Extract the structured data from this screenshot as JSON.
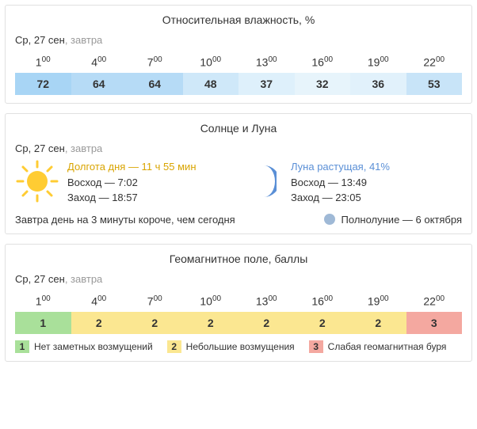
{
  "date_line": {
    "main": "Ср, 27 сен",
    "sub": ", завтра"
  },
  "hours": [
    "1",
    "4",
    "7",
    "10",
    "13",
    "16",
    "19",
    "22"
  ],
  "minute_sup": "00",
  "humidity": {
    "title": "Относительная влажность, %",
    "values": [
      "72",
      "64",
      "64",
      "48",
      "37",
      "32",
      "36",
      "53"
    ]
  },
  "sunmoon": {
    "title": "Солнце и Луна",
    "sun": {
      "day_length": "Долгота дня — 11 ч 55 мин",
      "rise": "Восход — 7:02",
      "set": "Заход — 18:57"
    },
    "moon": {
      "phase": "Луна растущая, 41%",
      "rise": "Восход — 13:49",
      "set": "Заход — 23:05"
    },
    "shorter_note": "Завтра день на 3 минуты короче, чем сегодня",
    "fullmoon": "Полнолуние — 6 октября"
  },
  "geomag": {
    "title": "Геомагнитное поле, баллы",
    "values": [
      "1",
      "2",
      "2",
      "2",
      "2",
      "2",
      "2",
      "3"
    ],
    "legend": [
      {
        "n": "1",
        "label": "Нет заметных возмущений"
      },
      {
        "n": "2",
        "label": "Небольшие возмущения"
      },
      {
        "n": "3",
        "label": "Слабая геомагнитная буря"
      }
    ]
  }
}
